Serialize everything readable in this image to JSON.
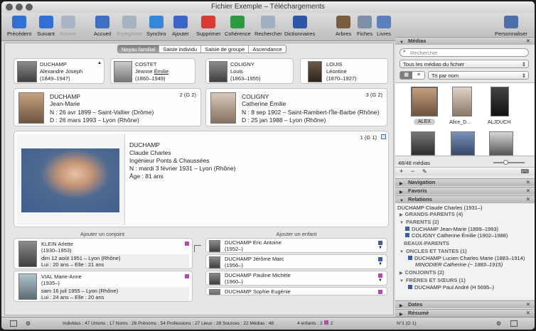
{
  "window": {
    "title": "Fichier Exemple – Téléchargements"
  },
  "toolbar": {
    "items": [
      {
        "label": "Précédent",
        "icon": "back-arrow-icon",
        "color": "#2f6fd6"
      },
      {
        "label": "Suivant",
        "icon": "forward-arrow-icon",
        "color": "#2f6fd6"
      },
      {
        "label": "Racine",
        "icon": "root-person-icon",
        "color": "#a9b6c7"
      },
      {
        "label": "Accueil",
        "icon": "home-icon",
        "color": "#3d6fc2"
      },
      {
        "label": "Enregistrer",
        "icon": "save-disk-icon",
        "color": "#a7b2c2"
      },
      {
        "label": "Synchro",
        "icon": "sync-icon",
        "color": "#3487d8"
      },
      {
        "label": "Ajouter",
        "icon": "add-plus-icon",
        "color": "#3b66c8"
      },
      {
        "label": "Supprimer",
        "icon": "delete-x-icon",
        "color": "#d93a32"
      },
      {
        "label": "Cohérence",
        "icon": "check-icon",
        "color": "#2c9a3f"
      },
      {
        "label": "Rechercher",
        "icon": "magnifier-icon",
        "color": "#9fb0c2"
      },
      {
        "label": "Dictionnaires",
        "icon": "book-icon",
        "color": "#2e55a8"
      },
      {
        "label": "Arbres",
        "icon": "tree-icon",
        "color": "#7a5c3f"
      },
      {
        "label": "Fiches",
        "icon": "cards-icon",
        "color": "#7d8fa6"
      },
      {
        "label": "Livres",
        "icon": "open-book-icon",
        "color": "#5b7fbd"
      },
      {
        "label": "Personnaliser",
        "icon": "tools-icon",
        "color": "#4a6fa9"
      }
    ]
  },
  "tabs": [
    {
      "label": "Noyau familial",
      "active": true
    },
    {
      "label": "Saisie individu",
      "active": false
    },
    {
      "label": "Saisie de groupe",
      "active": false
    },
    {
      "label": "Ascendance",
      "active": false
    }
  ],
  "grandparents": [
    {
      "surname": "DUCHAMP",
      "given": "Alexandre Joseph",
      "dates": "(1849–1947)"
    },
    {
      "surname": "COSTET",
      "given": "Jeanne",
      "given_u": "Émilie",
      "dates": "(1860–1949)"
    },
    {
      "surname": "COLIGNY",
      "given": "Louis",
      "dates": "(1863–1955)"
    },
    {
      "surname": "LOUIS",
      "given": "Léontine",
      "dates": "(1870–1927)"
    }
  ],
  "parents": [
    {
      "surname": "DUCHAMP",
      "given": "Jean-Marie",
      "birth": "N : 26 avr 1899 – Saint-Vallier (Drôme)",
      "death": "D : 26 mars 1993 – Lyon (Rhône)",
      "badge": "2 (G 2)"
    },
    {
      "surname": "COLIGNY",
      "given": "Catherine Émilie",
      "birth": "N : 8 sep 1902 – Saint-Rambert-l'Île-Barbe (Rhône)",
      "death": "D : 25 jan 1988 – Lyon (Rhône)",
      "badge": "3 (G 2)"
    }
  ],
  "main_person": {
    "surname": "DUCHAMP",
    "given": "Claude Charles",
    "occupation": "Ingénieur Ponts & Chaussées",
    "birth": "N : mardi 3 février 1931 – Lyon (Rhône)",
    "age": "Âge : 81 ans",
    "badge": "1 (G 1)"
  },
  "sections": {
    "spouse": "Ajouter un conjoint",
    "child": "Ajouter un enfant"
  },
  "spouses": [
    {
      "name": "KLEIN Arlette",
      "dates": "(1930–1953)",
      "marriage": "dim 12 août 1951 – Lyon (Rhône)",
      "ages": "Lui : 20 ans – Elle : 21 ans"
    },
    {
      "name": "VIAL Marie-Anne",
      "dates": "(1935–)",
      "marriage": "sam 16 juil 1955 – Lyon (Rhône)",
      "ages": "Lui : 24 ans – Elle : 20 ans"
    }
  ],
  "children": [
    {
      "name": "DUCHAMP Eric Antoine",
      "dates": "(1952–)",
      "color": "#3c5ea9"
    },
    {
      "name": "DUCHAMP Jérôme Marc",
      "dates": "(1956–)",
      "color": "#3c5ea9"
    },
    {
      "name": "DUCHAMP Pauline Michèle",
      "dates": "(1960–)",
      "color": "#b04bb0"
    },
    {
      "name": "DUCHAMP Sophie Eugénie",
      "dates": "(1965–)",
      "color": "#b04bb0"
    }
  ],
  "sidebar": {
    "media": {
      "title": "Médias",
      "search_placeholder": "Rechercher",
      "filter": "Tous les médias du fichier",
      "sort": "Tri par nom",
      "count": "48/48 médias",
      "thumbs": [
        "ALEX",
        "Alice_D...",
        "ALJDUCH",
        "",
        "",
        ""
      ]
    },
    "navigation": "Navigation",
    "favoris": "Favoris",
    "relations": "Relations",
    "relations_root": "DUCHAMP Claude Charles (1931–)",
    "relations_rows": [
      {
        "text": "GRANDS-PARENTS (4)",
        "kind": "group"
      },
      {
        "text": "PARENTS (2)",
        "kind": "group"
      },
      {
        "text": "DUCHAMP Jean-Marie (1899–1993)",
        "kind": "person"
      },
      {
        "text": "COLIGNY Catherine Émilie (1902–1988)",
        "kind": "person"
      },
      {
        "text": "BEAUX-PARENTS",
        "kind": "plain"
      },
      {
        "text": "ONCLES ET TANTES (1)",
        "kind": "group"
      },
      {
        "text": "DUCHAMP Lucien Charles Marie (1883–1914)",
        "kind": "person"
      },
      {
        "text": "MINODIER Catherine (~ 1883–1915)",
        "kind": "italic"
      },
      {
        "text": "CONJOINTS (2)",
        "kind": "group"
      },
      {
        "text": "FRÈRES ET SŒURS (1)",
        "kind": "group"
      },
      {
        "text": "DUCHAMP Paul André (H 5695–)",
        "kind": "person"
      }
    ],
    "dates": "Dates",
    "resume": "Résumé"
  },
  "statusbar": {
    "text": "Individus : 47   Unions : 17   Noms : 26   Prénoms : 54   Professions : 27   Lieux : 28   Sources : 22   Médias : 48",
    "children": "4 enfants : 2",
    "children2": "2",
    "number": "N°1 (G 1)"
  }
}
